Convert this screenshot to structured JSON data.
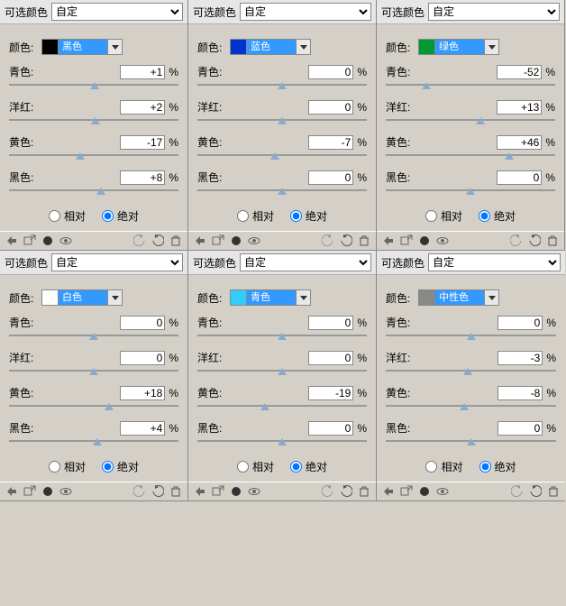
{
  "labels": {
    "selectiveColor": "可选颜色",
    "custom": "自定",
    "color": "颜色:",
    "cyan": "青色:",
    "magenta": "洋红:",
    "yellow": "黄色:",
    "black": "黑色:",
    "relative": "相对",
    "absolute": "绝对",
    "percent": "%"
  },
  "panels": [
    {
      "swatchColor": "#000000",
      "swatchName": "黑色",
      "cyan": "+1",
      "magenta": "+2",
      "yellow": "-17",
      "black": "+8",
      "mode": "absolute",
      "pos": {
        "c": 50.5,
        "m": 51,
        "y": 42,
        "k": 54
      }
    },
    {
      "swatchColor": "#0033cc",
      "swatchName": "蓝色",
      "cyan": "0",
      "magenta": "0",
      "yellow": "-7",
      "black": "0",
      "mode": "absolute",
      "pos": {
        "c": 50,
        "m": 50,
        "y": 46,
        "k": 50
      }
    },
    {
      "swatchColor": "#009933",
      "swatchName": "绿色",
      "cyan": "-52",
      "magenta": "+13",
      "yellow": "+46",
      "black": "0",
      "mode": "absolute",
      "pos": {
        "c": 24,
        "m": 56,
        "y": 73,
        "k": 50
      }
    },
    {
      "swatchColor": "#ffffff",
      "swatchName": "白色",
      "cyan": "0",
      "magenta": "0",
      "yellow": "+18",
      "black": "+4",
      "mode": "absolute",
      "pos": {
        "c": 50,
        "m": 50,
        "y": 59,
        "k": 52
      }
    },
    {
      "swatchColor": "#33ccff",
      "swatchName": "青色",
      "cyan": "0",
      "magenta": "0",
      "yellow": "-19",
      "black": "0",
      "mode": "absolute",
      "pos": {
        "c": 50,
        "m": 50,
        "y": 40,
        "k": 50
      }
    },
    {
      "swatchColor": "#888888",
      "swatchName": "中性色",
      "cyan": "0",
      "magenta": "-3",
      "yellow": "-8",
      "black": "0",
      "mode": "absolute",
      "pos": {
        "c": 50,
        "m": 48,
        "y": 46,
        "k": 50
      }
    }
  ]
}
